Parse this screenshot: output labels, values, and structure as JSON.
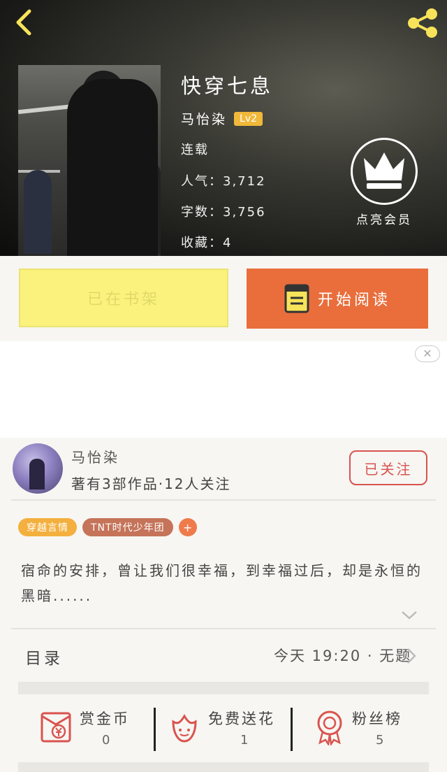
{
  "header": {
    "title": "快穿七息",
    "author": "马怡染",
    "level": "Lv2",
    "status": "连载",
    "popularity": "人气：3,712",
    "word_count": "字数：3,756",
    "favorites": "收藏：4",
    "vip_label": "点亮会员"
  },
  "actions": {
    "shelf_label": "已在书架",
    "read_label": "开始阅读"
  },
  "ad": {
    "close_glyph": "✕"
  },
  "author_card": {
    "name": "马怡染",
    "subtitle": "著有3部作品·12人关注",
    "follow_label": "已关注"
  },
  "tags": [
    "穿越言情",
    "TNT时代少年团"
  ],
  "tag_add": "+",
  "intro": "宿命的安排，曾让我们很幸福，到幸福过后，却是永恒的黑暗......",
  "toc": {
    "label": "目录",
    "update": "今天 19:20 · 无题"
  },
  "stats": [
    {
      "label": "赏金币",
      "value": "0",
      "icon": "red-envelope-icon"
    },
    {
      "label": "免费送花",
      "value": "1",
      "icon": "flower-icon"
    },
    {
      "label": "粉丝榜",
      "value": "5",
      "icon": "medal-icon"
    }
  ],
  "colors": {
    "accent_orange": "#e96e3c",
    "shelf_yellow": "#faf27c",
    "icon_yellow": "#f7e35a",
    "red": "#d9534f"
  }
}
